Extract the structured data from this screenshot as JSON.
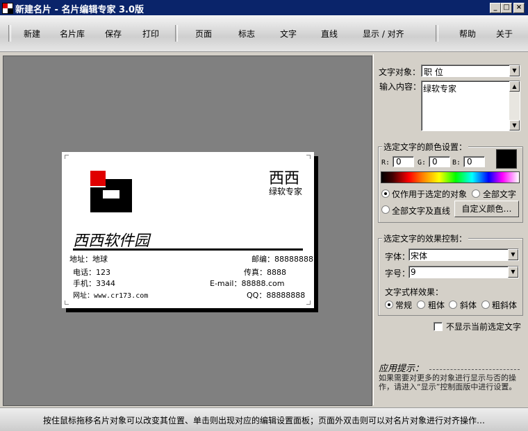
{
  "window": {
    "title": "新建名片 - 名片编辑专家 3.0版",
    "min": "_",
    "max": "□",
    "close": "×"
  },
  "toolbar": {
    "new": "新建",
    "library": "名片库",
    "save": "保存",
    "print": "打印",
    "page": "页面",
    "logo": "标志",
    "text": "文字",
    "line": "直线",
    "display": "显示 / 对齐",
    "help": "帮助",
    "about": "关于"
  },
  "card": {
    "name": "西西",
    "title": "绿软专家",
    "company": "西西软件园",
    "address": "地址：地球",
    "postcode": "邮编：88888888",
    "phone": "电话：123",
    "fax": "传真：8888",
    "mobile": "手机：3344",
    "email": "E-mail：88888.com",
    "website": "网址：www.cr173.com",
    "qq": "QQ：88888888",
    "logo_colors": {
      "red": "#e00000",
      "black": "#000000"
    }
  },
  "panel": {
    "text_object_label": "文字对象：",
    "text_object_value": "职 位",
    "input_label": "输入内容：",
    "input_value": "绿软专家",
    "color_group_title": "选定文字的颜色设置：",
    "r_label": "R:",
    "r_value": "0",
    "g_label": "G:",
    "g_value": "0",
    "b_label": "B:",
    "b_value": "0",
    "current_color": "#000000",
    "opt_selected_only": "仅作用于选定的对象",
    "opt_all_text": "全部文字",
    "opt_all_text_lines": "全部文字及直线",
    "custom_color_button": "自定义颜色…",
    "effect_group_title": "选定文字的效果控制：",
    "font_label": "字体：",
    "font_value": "宋体",
    "size_label": "字号：",
    "size_value": "9",
    "style_label": "文字式样效果：",
    "style_regular": "常规",
    "style_bold": "粗体",
    "style_italic": "斜体",
    "style_bold_italic": "粗斜体",
    "hide_selection_label": "不显示当前选定文字",
    "hint_title": "应用提示：",
    "hint_text": "如果需要对更多的对象进行显示与否的操作，请进入“显示”控制面版中进行设置。"
  },
  "status": {
    "text": "按住鼠标拖移名片对象可以改变其位置、单击则出现对应的编辑设置面板；页面外双击则可以对名片对象进行对齐操作…"
  }
}
